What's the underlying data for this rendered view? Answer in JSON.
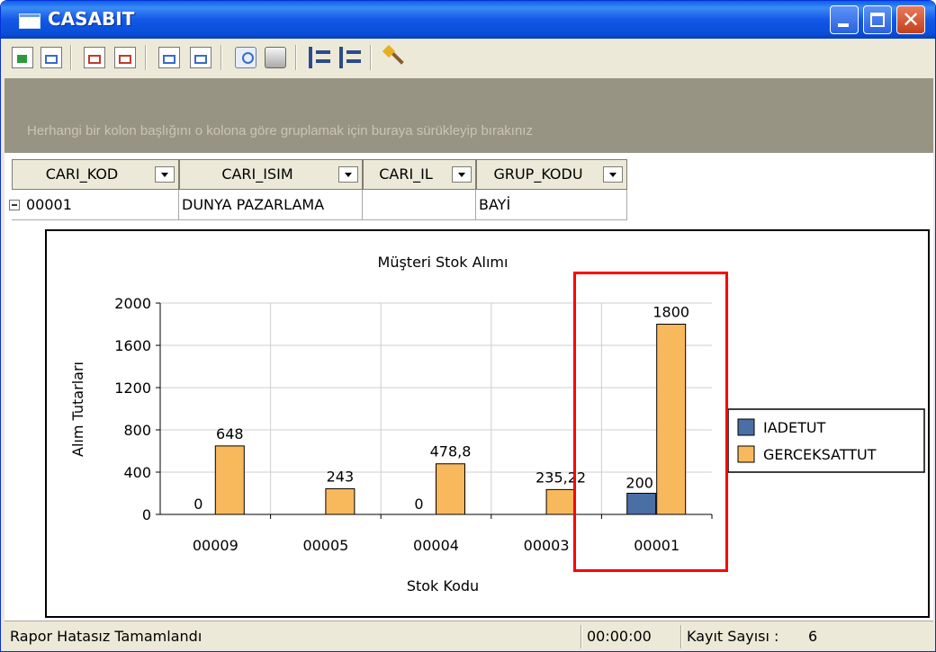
{
  "window": {
    "title": "CASABIT"
  },
  "toolbar": {
    "buttons": [
      "export-green",
      "import-blue",
      "open-report-red",
      "copy-report-red",
      "layout-blue",
      "layout-blue-2",
      "print-preview",
      "print",
      "tree-collapse",
      "tree-expand",
      "magic-wand"
    ]
  },
  "groupbar": {
    "text": "Herhangi bir kolon başlığını o kolona göre gruplamak için buraya sürükleyip bırakınız"
  },
  "grid": {
    "columns": [
      "CARI_KOD",
      "CARI_ISIM",
      "CARI_IL",
      "GRUP_KODU"
    ],
    "row": {
      "cari_kod": "00001",
      "cari_isim": "DUNYA PAZARLAMA",
      "cari_il": "",
      "grup_kodu": "BAYİ"
    }
  },
  "chart_data": {
    "type": "bar",
    "title": "Müşteri Stok Alımı",
    "xlabel": "Stok Kodu",
    "ylabel": "Alım Tutarları",
    "categories": [
      "00009",
      "00005",
      "00004",
      "00003",
      "00001"
    ],
    "series": [
      {
        "name": "IADETUT",
        "values": [
          0,
          null,
          0,
          null,
          200
        ],
        "labels": [
          "0",
          "",
          "0",
          "",
          "200"
        ],
        "color": "#4a6fa5"
      },
      {
        "name": "GERCEKSATTUT",
        "values": [
          648,
          243,
          478.8,
          235.22,
          1800
        ],
        "labels": [
          "648",
          "243",
          "478,8",
          "235,22",
          "1800"
        ],
        "color": "#f8b85c"
      }
    ],
    "ylim": [
      0,
      2000
    ],
    "yticks": [
      "0",
      "400",
      "800",
      "1200",
      "1600",
      "2000"
    ],
    "grid": true,
    "legend": "right"
  },
  "statusbar": {
    "message": "Rapor Hatasız Tamamlandı",
    "time": "00:00:00",
    "record_label": "Kayıt Sayısı :",
    "record_count": "6"
  }
}
